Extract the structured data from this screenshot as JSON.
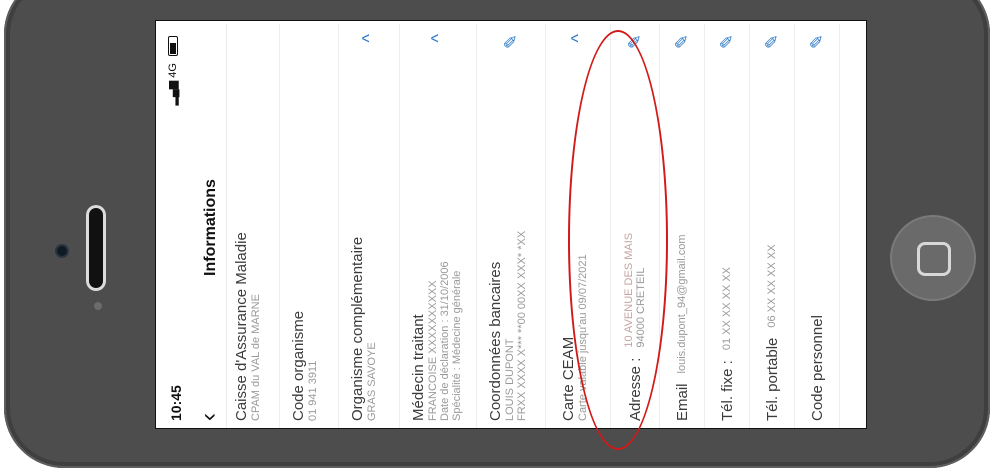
{
  "status_bar": {
    "time": "10:45",
    "network": "4G"
  },
  "nav": {
    "back_icon": "chevron-left-icon",
    "title": "Informations"
  },
  "rows": [
    {
      "title": "Caisse d'Assurance Maladie",
      "sub": [
        "CPAM du VAL de MARNE"
      ],
      "action": ""
    },
    {
      "title": "Code organisme",
      "sub": [
        "01 941 3911"
      ],
      "action": ""
    },
    {
      "title": "Organisme complémentaire",
      "sub": [
        "GRAS SAVOYE"
      ],
      "action": "^"
    },
    {
      "title": "Médecin traitant",
      "sub": [
        "FRANCOISE    XXXXXXXXXX",
        "Date de déclaration : 31/10/2006",
        "Spécialité : Médecine générale"
      ],
      "action": "^"
    },
    {
      "title": "Coordonnées bancaires",
      "sub": [
        "LOUIS DUPONT",
        "FRXX XXXX X*** **00 00XX XXX* *XX"
      ],
      "action": "✎"
    },
    {
      "title": "Carte CEAM",
      "sub": [
        "Carte valable jusqu'au 09/07/2021"
      ],
      "action": "^"
    }
  ],
  "inline_rows": [
    {
      "label": "Adresse :",
      "value": "94000 CRETEIL",
      "value_above": "10 AVENUE DES MAIS",
      "action": "✎"
    },
    {
      "label": "Email",
      "value": "louis.dupont_94@gmail.com",
      "action": "✎"
    },
    {
      "label": "Tél. fixe :",
      "value": "01 XX XX XX XX",
      "action": "✎"
    },
    {
      "label": "Tél. portable",
      "value": "06 XX XX XX XX",
      "action": "✎"
    },
    {
      "label": "Code personnel",
      "value": "",
      "action": "✎"
    }
  ],
  "colors": {
    "accent": "#2b78c6",
    "highlight": "#d11a1a",
    "phone_body": "#4d4d4d"
  }
}
